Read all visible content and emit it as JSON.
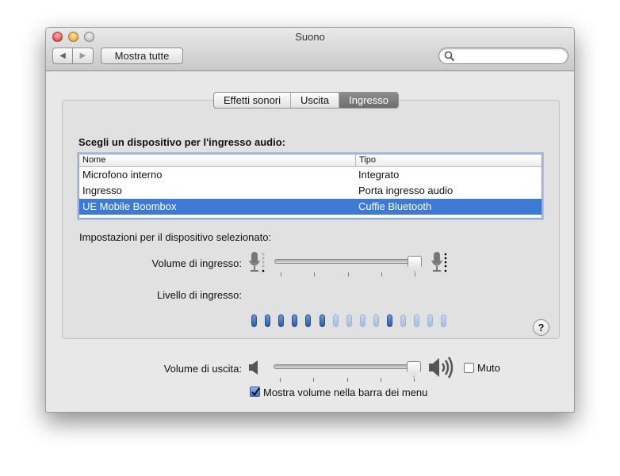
{
  "window": {
    "title": "Suono"
  },
  "toolbar": {
    "back": "◀",
    "forward": "▶",
    "show_all": "Mostra tutte",
    "search_placeholder": ""
  },
  "tabs": [
    {
      "label": "Effetti sonori"
    },
    {
      "label": "Uscita"
    },
    {
      "label": "Ingresso",
      "selected": true
    }
  ],
  "input": {
    "heading": "Scegli un dispositivo per l'ingresso audio:",
    "columns": [
      "Nome",
      "Tipo"
    ],
    "rows": [
      {
        "name": "Microfono interno",
        "type": "Integrato"
      },
      {
        "name": "Ingresso",
        "type": "Porta ingresso audio"
      },
      {
        "name": "UE Mobile Boombox",
        "type": "Cuffie Bluetooth",
        "selected": true
      }
    ],
    "settings_label": "Impostazioni per il dispositivo selezionato:",
    "volume_label": "Volume di ingresso:",
    "volume_value": 0.95,
    "level_label": "Livello di ingresso:",
    "level_pills": [
      1,
      1,
      1,
      1,
      1,
      1,
      0,
      0,
      0,
      0,
      1,
      0,
      0,
      0,
      0
    ]
  },
  "help": "?",
  "output": {
    "volume_label": "Volume di uscita:",
    "volume_value": 0.95,
    "mute_label": "Muto",
    "mute_checked": false,
    "show_in_menu_label": "Mostra volume nella barra dei menu",
    "show_in_menu_checked": true
  },
  "colors": {
    "selection": "#3d7ad6",
    "level_on": "#2d5aa5",
    "level_off": "#a7bde0"
  }
}
